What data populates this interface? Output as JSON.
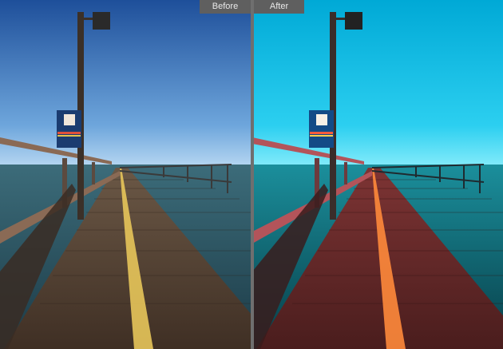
{
  "labels": {
    "before": "Before",
    "after": "After"
  },
  "colors": {
    "before_sky_top": "#1e4f9a",
    "before_sky_bottom": "#9ec6e8",
    "after_sky_top": "#00a9d6",
    "after_sky_bottom": "#6fe3f7",
    "before_water": "#2f5262",
    "after_water": "#0f6a76",
    "before_deck": "#5a4a3a",
    "after_deck": "#6a2b2b",
    "before_rail": "#8a6a55",
    "after_rail": "#b3545a",
    "center_line_before": "#e7c55a",
    "center_line_after": "#ff8a3b"
  }
}
